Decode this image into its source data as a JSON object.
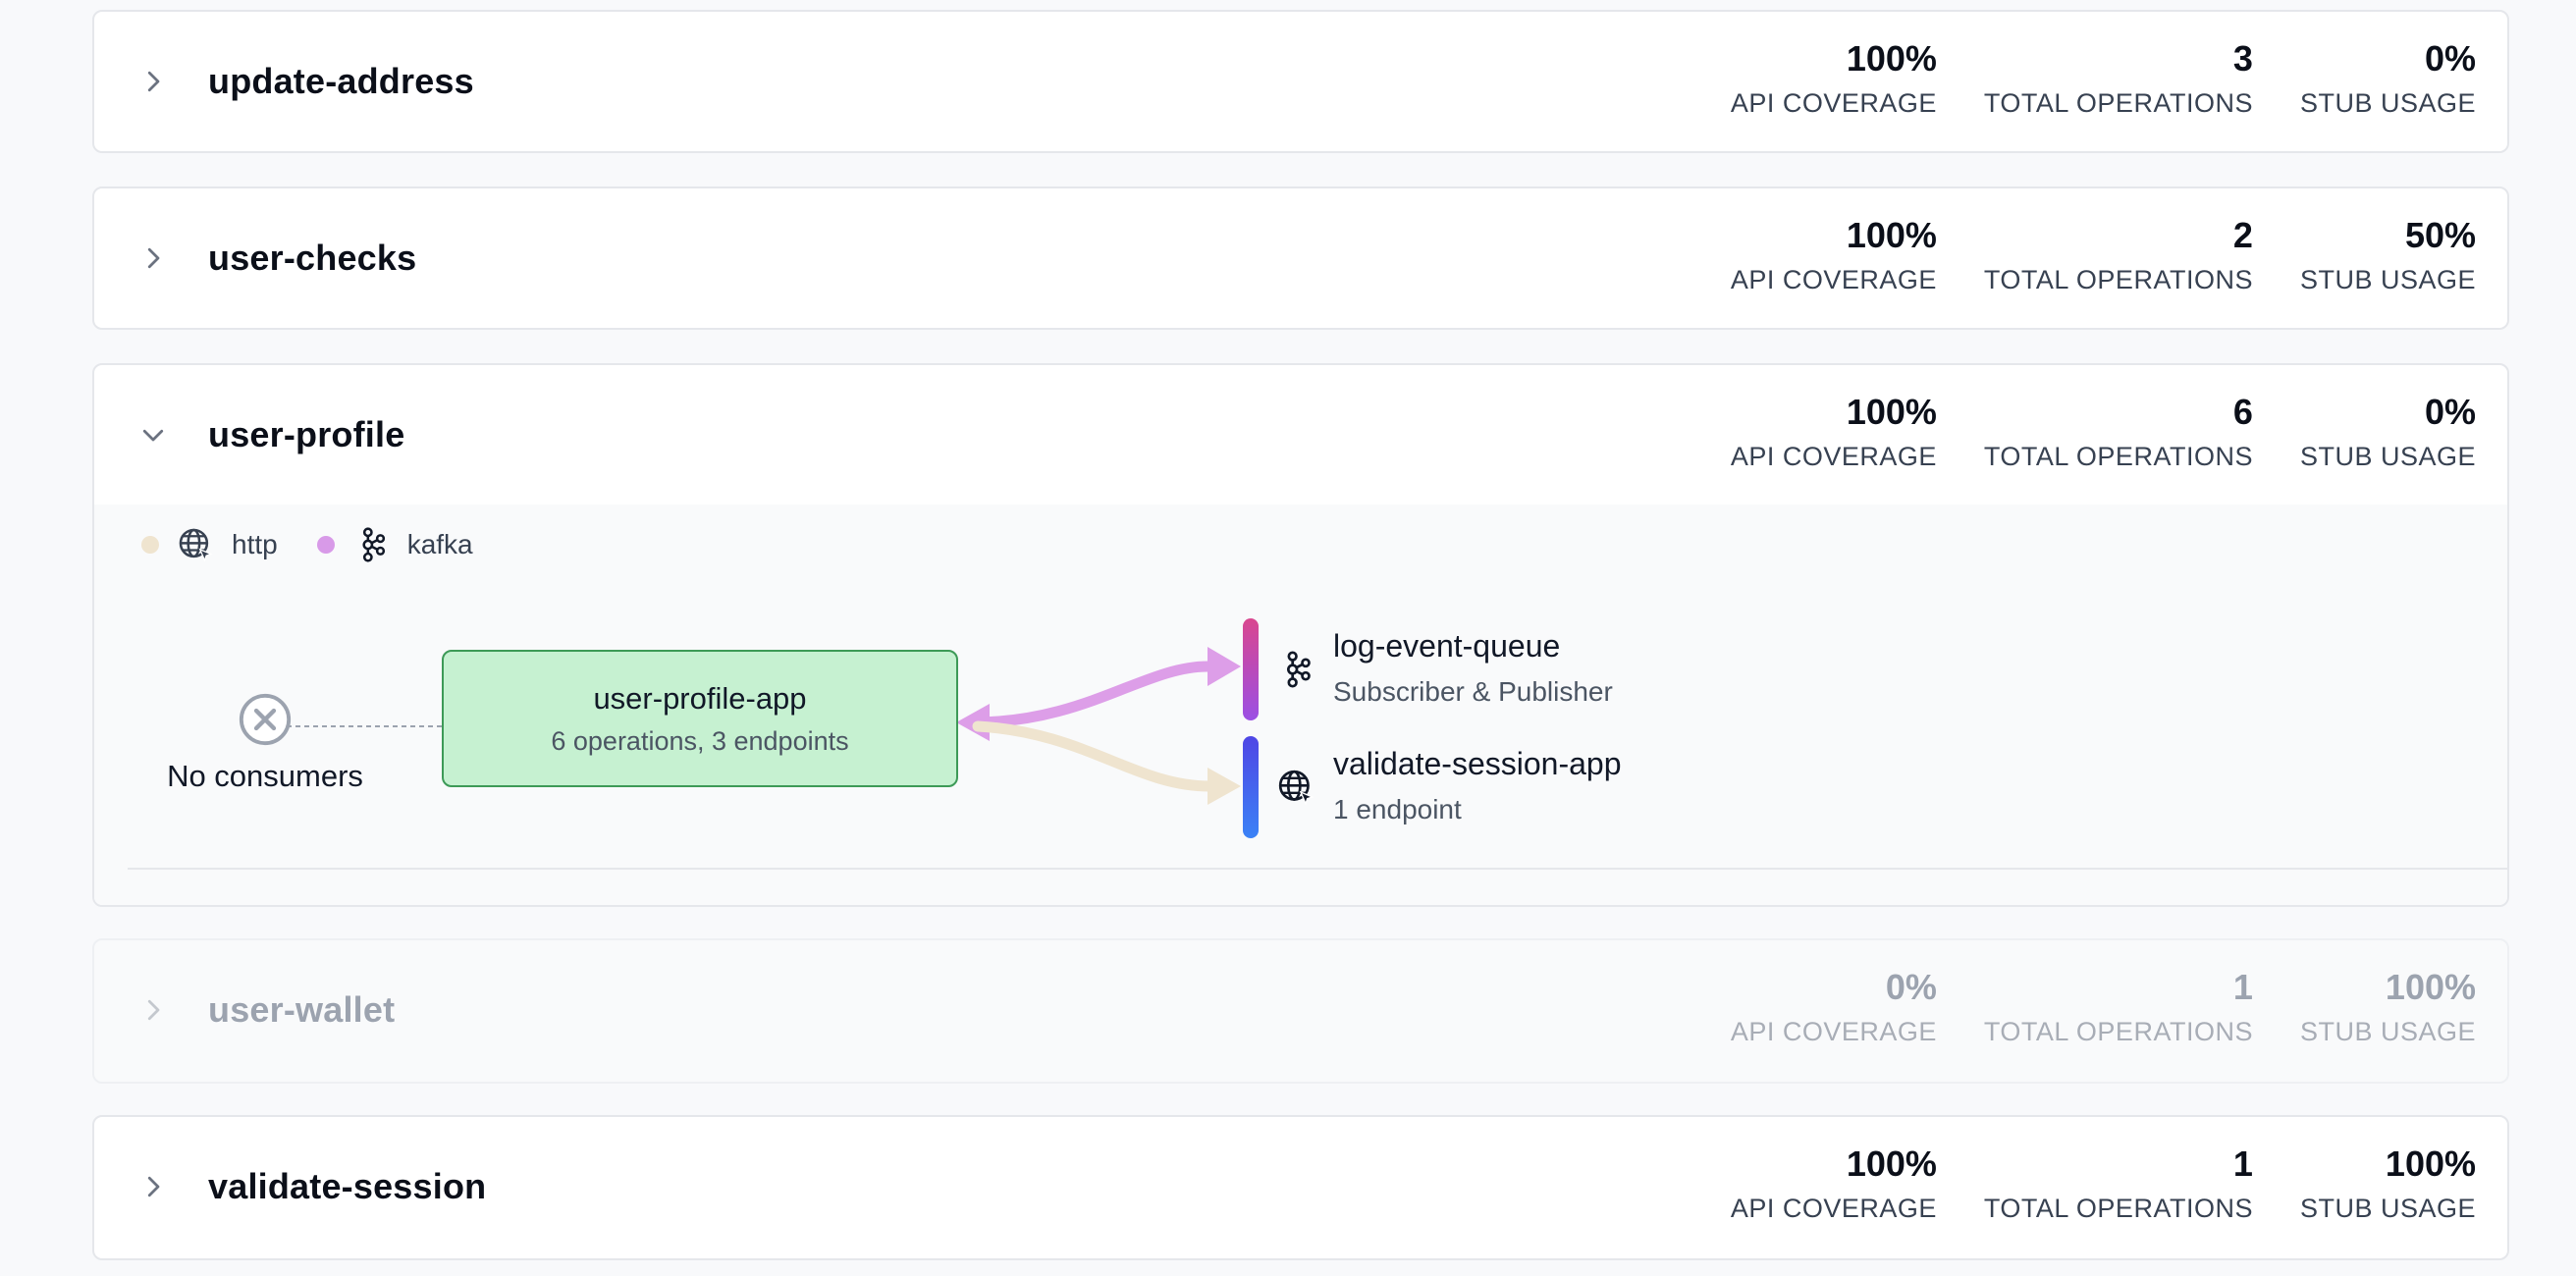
{
  "colors": {
    "http": "#efe4cf",
    "kafka": "#d89ae8",
    "app_fill": "#c6f1d1",
    "app_border": "#3d9a57"
  },
  "cards": [
    {
      "name": "update-address",
      "expanded": false,
      "disabled": false,
      "metrics": [
        {
          "value": "100%",
          "label": "API COVERAGE"
        },
        {
          "value": "3",
          "label": "TOTAL OPERATIONS"
        },
        {
          "value": "0%",
          "label": "STUB USAGE"
        }
      ]
    },
    {
      "name": "user-checks",
      "expanded": false,
      "disabled": false,
      "metrics": [
        {
          "value": "100%",
          "label": "API COVERAGE"
        },
        {
          "value": "2",
          "label": "TOTAL OPERATIONS"
        },
        {
          "value": "50%",
          "label": "STUB USAGE"
        }
      ]
    },
    {
      "name": "user-profile",
      "expanded": true,
      "disabled": false,
      "metrics": [
        {
          "value": "100%",
          "label": "API COVERAGE"
        },
        {
          "value": "6",
          "label": "TOTAL OPERATIONS"
        },
        {
          "value": "0%",
          "label": "STUB USAGE"
        }
      ]
    },
    {
      "name": "user-wallet",
      "expanded": false,
      "disabled": true,
      "metrics": [
        {
          "value": "0%",
          "label": "API COVERAGE"
        },
        {
          "value": "1",
          "label": "TOTAL OPERATIONS"
        },
        {
          "value": "100%",
          "label": "STUB USAGE"
        }
      ]
    },
    {
      "name": "validate-session",
      "expanded": false,
      "disabled": false,
      "metrics": [
        {
          "value": "100%",
          "label": "API COVERAGE"
        },
        {
          "value": "1",
          "label": "TOTAL OPERATIONS"
        },
        {
          "value": "100%",
          "label": "STUB USAGE"
        }
      ]
    }
  ],
  "graph": {
    "legend": [
      {
        "label": "http",
        "icon": "globe-icon"
      },
      {
        "label": "kafka",
        "icon": "kafka-icon"
      }
    ],
    "no_consumers": "No consumers",
    "app": {
      "title": "user-profile-app",
      "subtitle": "6 operations, 3 endpoints"
    },
    "dependencies": [
      {
        "title": "log-event-queue",
        "subtitle": "Subscriber & Publisher",
        "icon": "kafka-icon"
      },
      {
        "title": "validate-session-app",
        "subtitle": "1 endpoint",
        "icon": "globe-icon"
      }
    ]
  }
}
